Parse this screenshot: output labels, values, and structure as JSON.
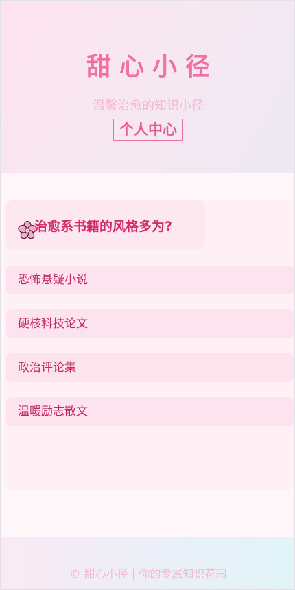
{
  "header": {
    "title": "甜心小径",
    "subtitle": "温馨治愈的知识小径",
    "profile_link": "个人中心"
  },
  "quiz": {
    "question": "治愈系书籍的风格多为?",
    "question_icon": "cherry-blossom-icon",
    "options": [
      "恐怖悬疑小说",
      "硬核科技论文",
      "政治评论集",
      "温暖励志散文"
    ]
  },
  "footer": {
    "text": "© 甜心小径 | 你的专属知识花园"
  },
  "colors": {
    "accent": "#f26fa3",
    "question": "#d42a6c",
    "option_text": "#c2285f",
    "option_bg": "#fde3ee"
  }
}
